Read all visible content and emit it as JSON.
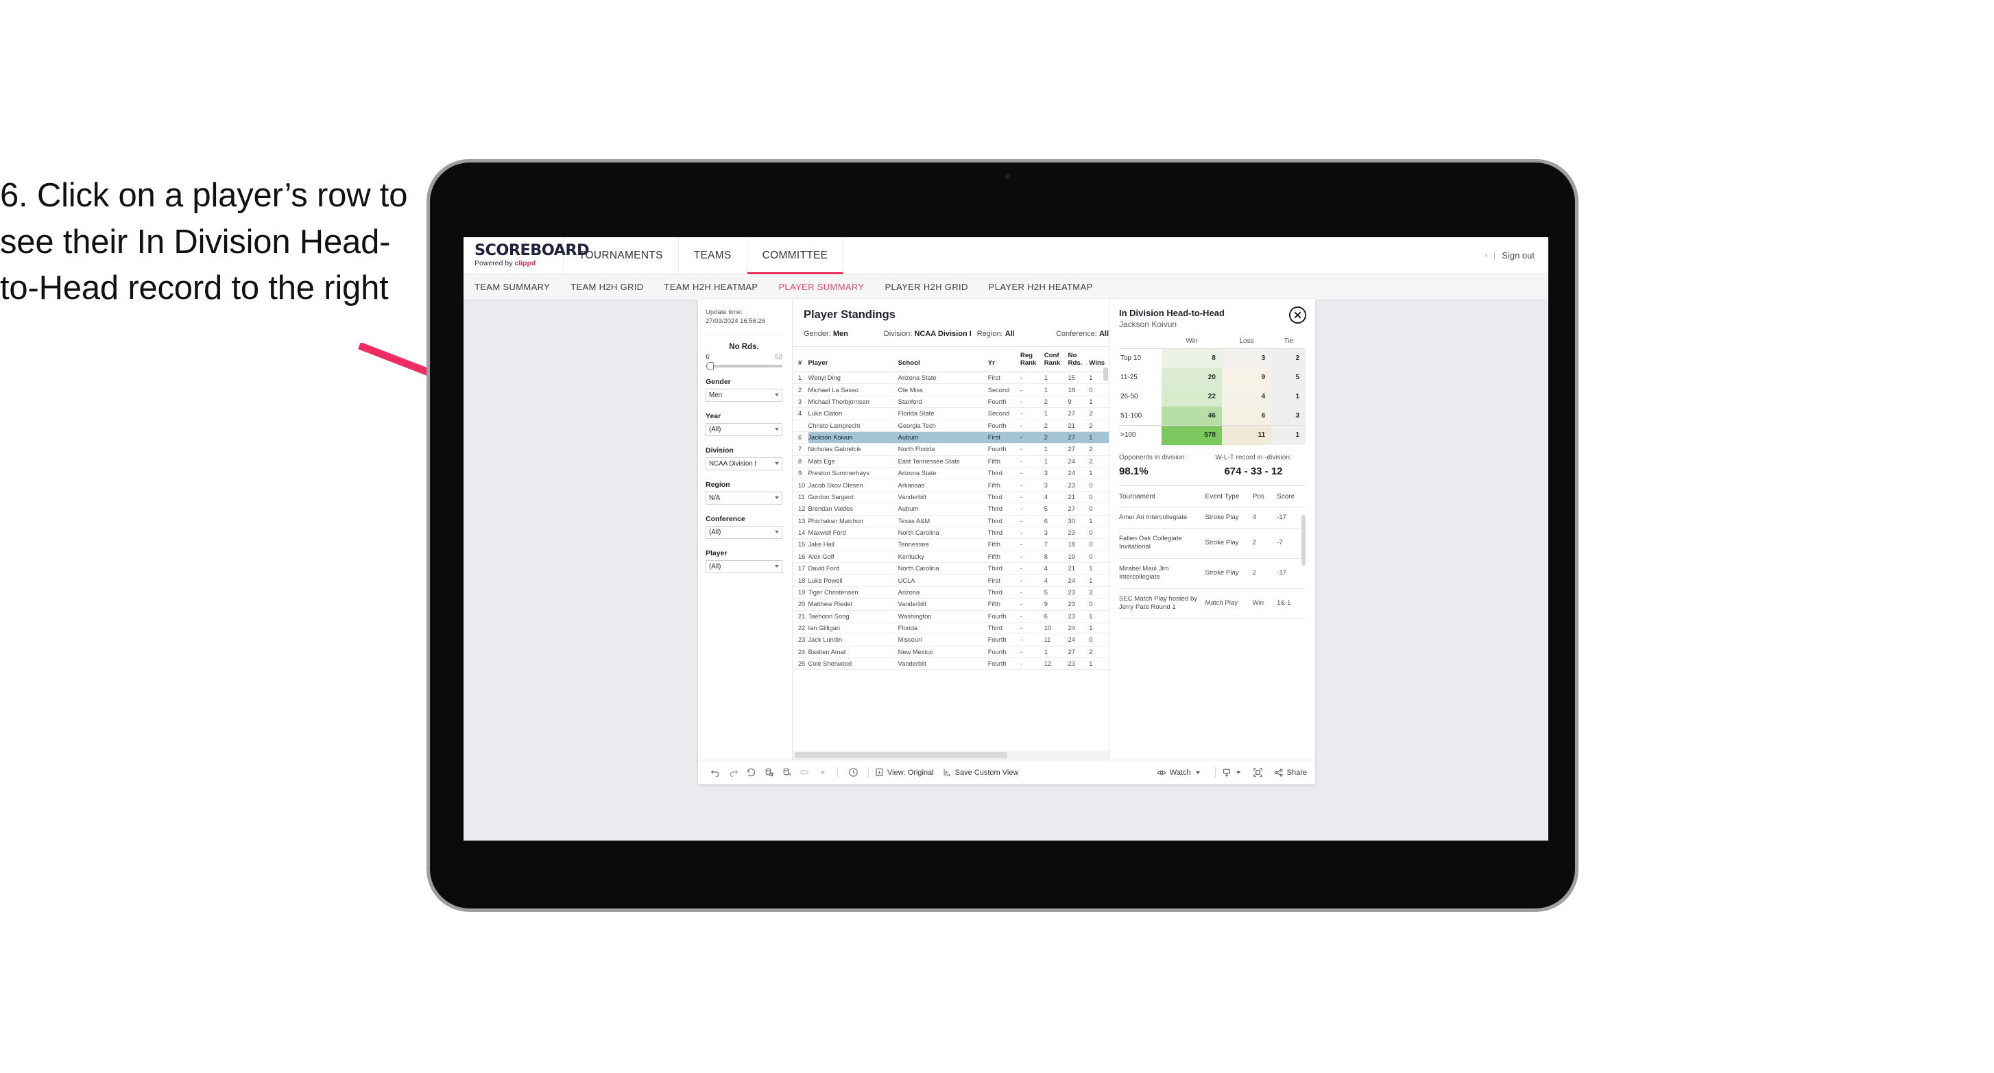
{
  "annotation": {
    "text": "6. Click on a player’s row to see their In Division Head-to-Head record to the right",
    "arrow_color": "#ef2c63"
  },
  "app": {
    "logo": {
      "main": "SCOREBOARD",
      "powered_prefix": "Powered by",
      "brand": "clippd"
    },
    "top_nav": [
      {
        "label": "TOURNAMENTS",
        "active": false
      },
      {
        "label": "TEAMS",
        "active": false
      },
      {
        "label": "COMMITTEE",
        "active": true
      }
    ],
    "top_right": {
      "chevron": "›",
      "separator": "|",
      "sign_out": "Sign out"
    },
    "sub_nav": [
      {
        "label": "TEAM SUMMARY",
        "active": false
      },
      {
        "label": "TEAM H2H GRID",
        "active": false
      },
      {
        "label": "TEAM H2H HEATMAP",
        "active": false
      },
      {
        "label": "PLAYER SUMMARY",
        "active": true
      },
      {
        "label": "PLAYER H2H GRID",
        "active": false
      },
      {
        "label": "PLAYER H2H HEATMAP",
        "active": false
      }
    ],
    "accent_color": "#ec2f56"
  },
  "filters": {
    "update_time_label": "Update time:",
    "update_time_value": "27/03/2024 16:56:26",
    "slider": {
      "title": "No Rds.",
      "min": "6",
      "max": "52"
    },
    "controls": [
      {
        "label": "Gender",
        "value": "Men"
      },
      {
        "label": "Year",
        "value": "(All)"
      },
      {
        "label": "Division",
        "value": "NCAA Division I"
      },
      {
        "label": "Region",
        "value": "N/A"
      },
      {
        "label": "Conference",
        "value": "(All)"
      },
      {
        "label": "Player",
        "value": "(All)"
      }
    ]
  },
  "standings": {
    "title": "Player Standings",
    "meta": [
      {
        "label": "Gender:",
        "value": "Men"
      },
      {
        "label": "Division:",
        "value": "NCAA Division I"
      },
      {
        "label": "Region:",
        "value": "All"
      },
      {
        "label": "Conference:",
        "value": "All"
      }
    ],
    "columns": [
      "#",
      "Player",
      "School",
      "Yr",
      "Reg Rank",
      "Conf Rank",
      "No Rds.",
      "Wins"
    ],
    "rows": [
      {
        "num": "1",
        "player": "Wenyi Ding",
        "school": "Arizona State",
        "yr": "First",
        "reg": "-",
        "conf": "1",
        "rds": "15",
        "wins": "1",
        "selected": false
      },
      {
        "num": "2",
        "player": "Michael La Sasso",
        "school": "Ole Miss",
        "yr": "Second",
        "reg": "-",
        "conf": "1",
        "rds": "18",
        "wins": "0",
        "selected": false
      },
      {
        "num": "3",
        "player": "Michael Thorbjornsen",
        "school": "Stanford",
        "yr": "Fourth",
        "reg": "-",
        "conf": "2",
        "rds": "9",
        "wins": "1",
        "selected": false
      },
      {
        "num": "4",
        "player": "Luke Claton",
        "school": "Florida State",
        "yr": "Second",
        "reg": "-",
        "conf": "1",
        "rds": "27",
        "wins": "2",
        "selected": false
      },
      {
        "num": "",
        "player": "Christo Lamprecht",
        "school": "Georgia Tech",
        "yr": "Fourth",
        "reg": "-",
        "conf": "2",
        "rds": "21",
        "wins": "2",
        "selected": false
      },
      {
        "num": "6",
        "player": "Jackson Koivun",
        "school": "Auburn",
        "yr": "First",
        "reg": "-",
        "conf": "2",
        "rds": "27",
        "wins": "1",
        "selected": true
      },
      {
        "num": "7",
        "player": "Nicholas Gabrelcik",
        "school": "North Florida",
        "yr": "Fourth",
        "reg": "-",
        "conf": "1",
        "rds": "27",
        "wins": "2",
        "selected": false
      },
      {
        "num": "8",
        "player": "Mats Ege",
        "school": "East Tennessee State",
        "yr": "Fifth",
        "reg": "-",
        "conf": "1",
        "rds": "24",
        "wins": "2",
        "selected": false
      },
      {
        "num": "9",
        "player": "Preston Summerhays",
        "school": "Arizona State",
        "yr": "Third",
        "reg": "-",
        "conf": "3",
        "rds": "24",
        "wins": "1",
        "selected": false
      },
      {
        "num": "10",
        "player": "Jacob Skov Olesen",
        "school": "Arkansas",
        "yr": "Fifth",
        "reg": "-",
        "conf": "3",
        "rds": "23",
        "wins": "0",
        "selected": false
      },
      {
        "num": "11",
        "player": "Gordon Sargent",
        "school": "Vanderbilt",
        "yr": "Third",
        "reg": "-",
        "conf": "4",
        "rds": "21",
        "wins": "0",
        "selected": false
      },
      {
        "num": "12",
        "player": "Brendan Valdes",
        "school": "Auburn",
        "yr": "Third",
        "reg": "-",
        "conf": "5",
        "rds": "27",
        "wins": "0",
        "selected": false
      },
      {
        "num": "13",
        "player": "Phichaksn Maichon",
        "school": "Texas A&M",
        "yr": "Third",
        "reg": "-",
        "conf": "6",
        "rds": "30",
        "wins": "1",
        "selected": false
      },
      {
        "num": "14",
        "player": "Maxwell Ford",
        "school": "North Carolina",
        "yr": "Third",
        "reg": "-",
        "conf": "3",
        "rds": "23",
        "wins": "0",
        "selected": false
      },
      {
        "num": "15",
        "player": "Jake Hall",
        "school": "Tennessee",
        "yr": "Fifth",
        "reg": "-",
        "conf": "7",
        "rds": "18",
        "wins": "0",
        "selected": false
      },
      {
        "num": "16",
        "player": "Alex Goff",
        "school": "Kentucky",
        "yr": "Fifth",
        "reg": "-",
        "conf": "8",
        "rds": "19",
        "wins": "0",
        "selected": false
      },
      {
        "num": "17",
        "player": "David Ford",
        "school": "North Carolina",
        "yr": "Third",
        "reg": "-",
        "conf": "4",
        "rds": "21",
        "wins": "1",
        "selected": false
      },
      {
        "num": "18",
        "player": "Luke Powell",
        "school": "UCLA",
        "yr": "First",
        "reg": "-",
        "conf": "4",
        "rds": "24",
        "wins": "1",
        "selected": false
      },
      {
        "num": "19",
        "player": "Tiger Christensen",
        "school": "Arizona",
        "yr": "Third",
        "reg": "-",
        "conf": "5",
        "rds": "23",
        "wins": "2",
        "selected": false
      },
      {
        "num": "20",
        "player": "Matthew Riedel",
        "school": "Vanderbilt",
        "yr": "Fifth",
        "reg": "-",
        "conf": "9",
        "rds": "23",
        "wins": "0",
        "selected": false
      },
      {
        "num": "21",
        "player": "Taehoon Song",
        "school": "Washington",
        "yr": "Fourth",
        "reg": "-",
        "conf": "6",
        "rds": "23",
        "wins": "1",
        "selected": false
      },
      {
        "num": "22",
        "player": "Ian Gilligan",
        "school": "Florida",
        "yr": "Third",
        "reg": "-",
        "conf": "10",
        "rds": "24",
        "wins": "1",
        "selected": false
      },
      {
        "num": "23",
        "player": "Jack Lundin",
        "school": "Missouri",
        "yr": "Fourth",
        "reg": "-",
        "conf": "11",
        "rds": "24",
        "wins": "0",
        "selected": false
      },
      {
        "num": "24",
        "player": "Bastien Amat",
        "school": "New Mexico",
        "yr": "Fourth",
        "reg": "-",
        "conf": "1",
        "rds": "27",
        "wins": "2",
        "selected": false
      },
      {
        "num": "25",
        "player": "Cole Sherwood",
        "school": "Vanderbilt",
        "yr": "Fourth",
        "reg": "-",
        "conf": "12",
        "rds": "23",
        "wins": "1",
        "selected": false
      }
    ]
  },
  "h2h": {
    "title": "In Division Head-to-Head",
    "player": "Jackson Koivun",
    "close_icon": "close-circle-icon",
    "columns": [
      "",
      "Win",
      "Loss",
      "Tie"
    ],
    "rows": [
      {
        "label": "Top 10",
        "win": "8",
        "loss": "3",
        "tie": "2",
        "win_bg": "#eaf3e6",
        "loss_bg": "#f2f1ee",
        "tie_bg": "#efefef"
      },
      {
        "label": "11-25",
        "win": "20",
        "loss": "9",
        "tie": "5",
        "win_bg": "#dbecd2",
        "loss_bg": "#f6f2e5",
        "tie_bg": "#efefef"
      },
      {
        "label": "26-50",
        "win": "22",
        "loss": "4",
        "tie": "1",
        "win_bg": "#d7ebcd",
        "loss_bg": "#f4f1ea",
        "tie_bg": "#efefef"
      },
      {
        "label": "51-100",
        "win": "46",
        "loss": "6",
        "tie": "3",
        "win_bg": "#b7dea6",
        "loss_bg": "#f4f0e4",
        "tie_bg": "#efefef"
      },
      {
        "label": ">100",
        "win": "578",
        "loss": "11",
        "tie": "1",
        "win_bg": "#7ac85e",
        "loss_bg": "#f0ead8",
        "tie_bg": "#efefef"
      }
    ],
    "stats": [
      {
        "label": "Opponents in division:",
        "value": "98.1%"
      },
      {
        "label": "W-L-T record in -division:",
        "value": "674 - 33 - 12"
      }
    ],
    "tournament_columns": [
      "Tournament",
      "Event Type",
      "Pos",
      "Score"
    ],
    "tournaments": [
      {
        "name": "Amer Ari Intercollegiate",
        "type": "Stroke Play",
        "pos": "4",
        "score": "-17"
      },
      {
        "name": "Fallen Oak Collegiate Invitational",
        "type": "Stroke Play",
        "pos": "2",
        "score": "-7"
      },
      {
        "name": "Mirabel Maui Jim Intercollegiate",
        "type": "Stroke Play",
        "pos": "2",
        "score": "-17"
      },
      {
        "name": "SEC Match Play hosted by Jerry Pate Round 1",
        "type": "Match Play",
        "pos": "Win",
        "score": "1&-1"
      }
    ]
  },
  "toolbar": {
    "icons": [
      "undo-icon",
      "redo-icon",
      "revert-icon",
      "refresh-data-icon",
      "pause-updates-icon",
      "highlight-icon"
    ],
    "clock_icon": "clock-icon",
    "view_label": "View: Original",
    "view_icon": "view-original-icon",
    "save_label": "Save Custom View",
    "save_icon": "save-view-icon",
    "watch_label": "Watch",
    "watch_icon": "eye-icon",
    "download_icon": "download-icon",
    "fullscreen_icon": "fullscreen-icon",
    "share_label": "Share",
    "share_icon": "share-icon"
  }
}
